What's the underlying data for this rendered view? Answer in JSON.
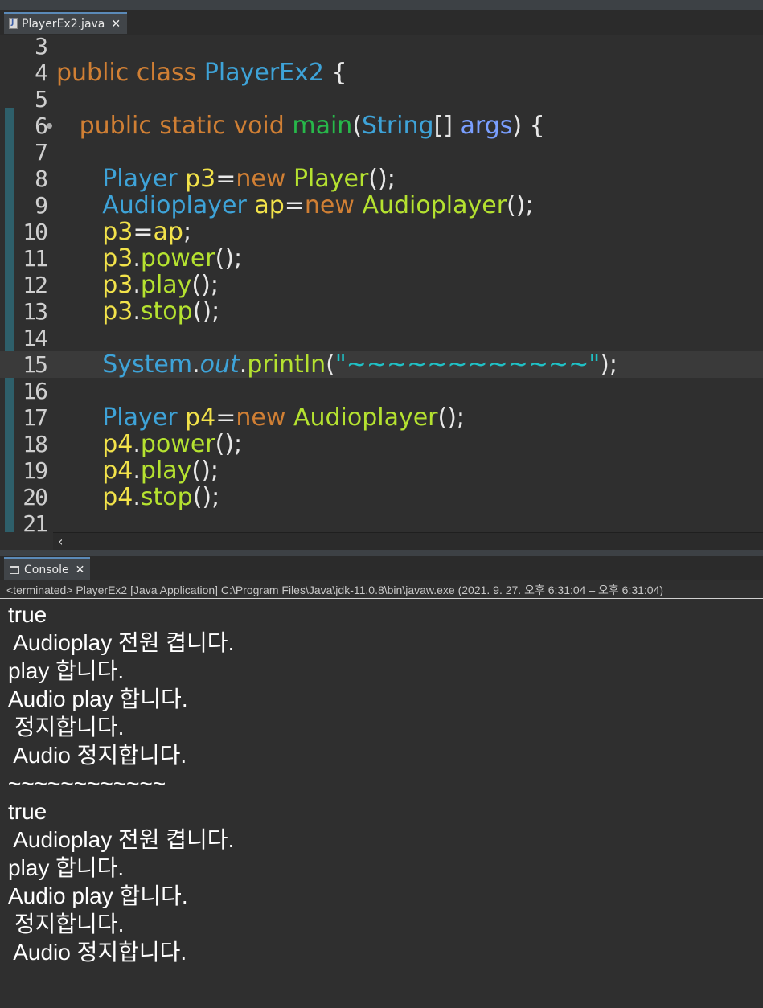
{
  "editor": {
    "tab_label": "PlayerEx2.java",
    "lines": [
      {
        "num": "3",
        "parts": []
      },
      {
        "num": "4",
        "parts": [
          {
            "t": "public class ",
            "c": "kw"
          },
          {
            "t": "PlayerEx2",
            "c": "cls"
          },
          {
            "t": " {",
            "c": ""
          }
        ]
      },
      {
        "num": "5",
        "parts": []
      },
      {
        "num": "6",
        "fold": true,
        "parts": [
          {
            "t": "   ",
            "c": ""
          },
          {
            "t": "public static void ",
            "c": "kw"
          },
          {
            "t": "main",
            "c": "mdef"
          },
          {
            "t": "(",
            "c": ""
          },
          {
            "t": "String",
            "c": "cls"
          },
          {
            "t": "[] ",
            "c": ""
          },
          {
            "t": "args",
            "c": "param"
          },
          {
            "t": ") {",
            "c": ""
          }
        ]
      },
      {
        "num": "7",
        "parts": []
      },
      {
        "num": "8",
        "parts": [
          {
            "t": "      ",
            "c": ""
          },
          {
            "t": "Player ",
            "c": "cls"
          },
          {
            "t": "p3",
            "c": "var"
          },
          {
            "t": "=",
            "c": ""
          },
          {
            "t": "new ",
            "c": "kw"
          },
          {
            "t": "Player",
            "c": "mth"
          },
          {
            "t": "();",
            "c": ""
          }
        ]
      },
      {
        "num": "9",
        "parts": [
          {
            "t": "      ",
            "c": ""
          },
          {
            "t": "Audioplayer ",
            "c": "cls"
          },
          {
            "t": "ap",
            "c": "var"
          },
          {
            "t": "=",
            "c": ""
          },
          {
            "t": "new ",
            "c": "kw"
          },
          {
            "t": "Audioplayer",
            "c": "mth"
          },
          {
            "t": "();",
            "c": ""
          }
        ]
      },
      {
        "num": "10",
        "parts": [
          {
            "t": "      ",
            "c": ""
          },
          {
            "t": "p3",
            "c": "var"
          },
          {
            "t": "=",
            "c": ""
          },
          {
            "t": "ap",
            "c": "var"
          },
          {
            "t": ";",
            "c": ""
          }
        ]
      },
      {
        "num": "11",
        "parts": [
          {
            "t": "      ",
            "c": ""
          },
          {
            "t": "p3",
            "c": "var"
          },
          {
            "t": ".",
            "c": ""
          },
          {
            "t": "power",
            "c": "mth"
          },
          {
            "t": "();",
            "c": ""
          }
        ]
      },
      {
        "num": "12",
        "parts": [
          {
            "t": "      ",
            "c": ""
          },
          {
            "t": "p3",
            "c": "var"
          },
          {
            "t": ".",
            "c": ""
          },
          {
            "t": "play",
            "c": "mth"
          },
          {
            "t": "();",
            "c": ""
          }
        ]
      },
      {
        "num": "13",
        "parts": [
          {
            "t": "      ",
            "c": ""
          },
          {
            "t": "p3",
            "c": "var"
          },
          {
            "t": ".",
            "c": ""
          },
          {
            "t": "stop",
            "c": "mth"
          },
          {
            "t": "();",
            "c": ""
          }
        ]
      },
      {
        "num": "14",
        "parts": []
      },
      {
        "num": "15",
        "current": true,
        "parts": [
          {
            "t": "      ",
            "c": ""
          },
          {
            "t": "System",
            "c": "cls"
          },
          {
            "t": ".",
            "c": ""
          },
          {
            "t": "out",
            "c": "fld"
          },
          {
            "t": ".",
            "c": ""
          },
          {
            "t": "println",
            "c": "mth"
          },
          {
            "t": "(",
            "c": ""
          },
          {
            "t": "\"~~~~~~~~~~~~\"",
            "c": "str"
          },
          {
            "t": ");",
            "c": ""
          }
        ]
      },
      {
        "num": "16",
        "parts": []
      },
      {
        "num": "17",
        "parts": [
          {
            "t": "      ",
            "c": ""
          },
          {
            "t": "Player ",
            "c": "cls"
          },
          {
            "t": "p4",
            "c": "var"
          },
          {
            "t": "=",
            "c": ""
          },
          {
            "t": "new ",
            "c": "kw"
          },
          {
            "t": "Audioplayer",
            "c": "mth"
          },
          {
            "t": "();",
            "c": ""
          }
        ]
      },
      {
        "num": "18",
        "parts": [
          {
            "t": "      ",
            "c": ""
          },
          {
            "t": "p4",
            "c": "var"
          },
          {
            "t": ".",
            "c": ""
          },
          {
            "t": "power",
            "c": "mth"
          },
          {
            "t": "();",
            "c": ""
          }
        ]
      },
      {
        "num": "19",
        "parts": [
          {
            "t": "      ",
            "c": ""
          },
          {
            "t": "p4",
            "c": "var"
          },
          {
            "t": ".",
            "c": ""
          },
          {
            "t": "play",
            "c": "mth"
          },
          {
            "t": "();",
            "c": ""
          }
        ]
      },
      {
        "num": "20",
        "parts": [
          {
            "t": "      ",
            "c": ""
          },
          {
            "t": "p4",
            "c": "var"
          },
          {
            "t": ".",
            "c": ""
          },
          {
            "t": "stop",
            "c": "mth"
          },
          {
            "t": "();",
            "c": ""
          }
        ]
      },
      {
        "num": "21",
        "parts": []
      }
    ]
  },
  "console": {
    "tab_label": "Console",
    "status": "<terminated> PlayerEx2 [Java Application] C:\\Program Files\\Java\\jdk-11.0.8\\bin\\javaw.exe  (2021. 9. 27. 오후 6:31:04 – 오후 6:31:04)",
    "output": [
      "true",
      " Audioplay 전원 켭니다.",
      "play 합니다.",
      "Audio play 합니다.",
      " 정지합니다.",
      " Audio 정지합니다.",
      "~~~~~~~~~~~~",
      "true",
      " Audioplay 전원 켭니다.",
      "play 합니다.",
      "Audio play 합니다.",
      " 정지합니다.",
      " Audio 정지합니다."
    ]
  }
}
